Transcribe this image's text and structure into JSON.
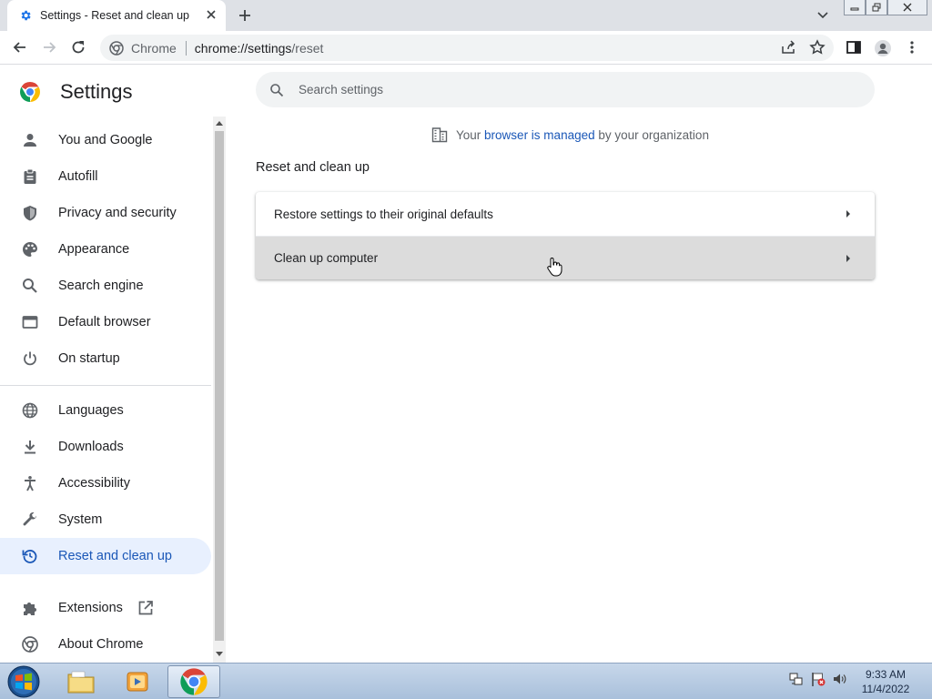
{
  "browser": {
    "tab_title": "Settings - Reset and clean up",
    "omnibox_site": "Chrome",
    "url_host": "chrome://settings",
    "url_path": "/reset"
  },
  "sidebar": {
    "title": "Settings",
    "items": [
      {
        "label": "You and Google",
        "icon": "person-icon"
      },
      {
        "label": "Autofill",
        "icon": "clipboard-icon"
      },
      {
        "label": "Privacy and security",
        "icon": "shield-icon"
      },
      {
        "label": "Appearance",
        "icon": "palette-icon"
      },
      {
        "label": "Search engine",
        "icon": "search-icon"
      },
      {
        "label": "Default browser",
        "icon": "browser-window-icon"
      },
      {
        "label": "On startup",
        "icon": "power-icon"
      },
      {
        "label": "Languages",
        "icon": "globe-icon"
      },
      {
        "label": "Downloads",
        "icon": "download-icon"
      },
      {
        "label": "Accessibility",
        "icon": "accessibility-icon"
      },
      {
        "label": "System",
        "icon": "wrench-icon"
      },
      {
        "label": "Reset and clean up",
        "icon": "reset-icon",
        "active": true
      },
      {
        "label": "Extensions",
        "icon": "puzzle-icon"
      },
      {
        "label": "About Chrome",
        "icon": "chrome-icon"
      }
    ]
  },
  "main": {
    "search_placeholder": "Search settings",
    "managed_prefix": "Your",
    "managed_link": "browser is managed",
    "managed_suffix": "by your organization",
    "section_title": "Reset and clean up",
    "rows": [
      {
        "label": "Restore settings to their original defaults"
      },
      {
        "label": "Clean up computer"
      }
    ]
  },
  "taskbar": {
    "time": "9:33 AM",
    "date": "11/4/2022"
  },
  "colors": {
    "accent": "#1a57b7",
    "active_nav_bg": "#e8f0fe"
  }
}
